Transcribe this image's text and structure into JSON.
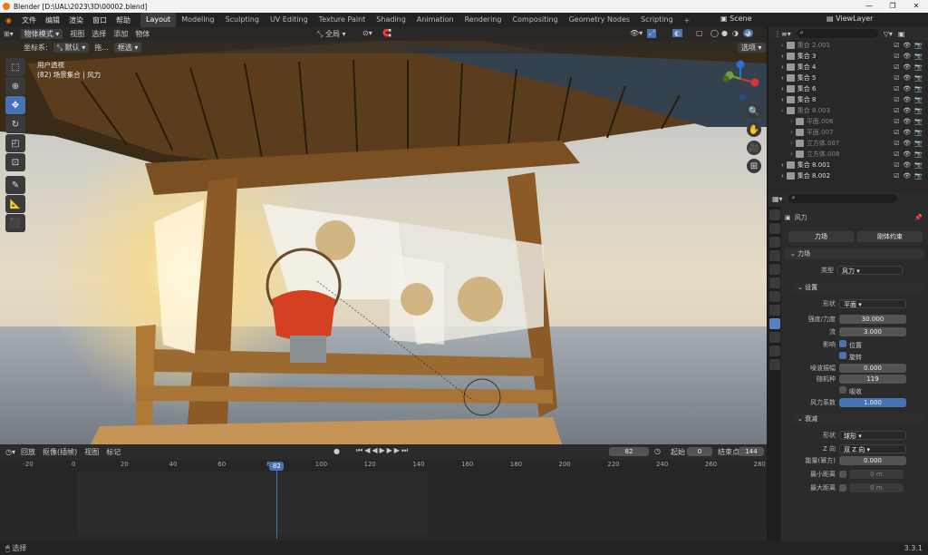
{
  "app": {
    "title": "Blender [D:\\UAL\\2023\\3D\\00002.blend]",
    "version": "3.3.1"
  },
  "menu": [
    "文件",
    "编辑",
    "渲染",
    "窗口",
    "帮助"
  ],
  "workspaces": [
    "Layout",
    "Modeling",
    "Sculpting",
    "UV Editing",
    "Texture Paint",
    "Shading",
    "Animation",
    "Rendering",
    "Compositing",
    "Geometry Nodes",
    "Scripting"
  ],
  "scene": "Scene",
  "viewlayer": "ViewLayer",
  "viewport": {
    "mode": "物体模式",
    "menus": [
      "视图",
      "选择",
      "添加",
      "物体"
    ],
    "coord_label": "坐标系:",
    "coord_value": "默认",
    "drag_label": "拖...",
    "select_mode": "框选",
    "transform": "全局",
    "options": "选项",
    "overlay_view": "用户透视",
    "overlay_info": "(82) 场景集合 | 风力"
  },
  "timeline": {
    "menus": [
      "回放",
      "抠像(插帧)",
      "视图",
      "标记"
    ],
    "current": "82",
    "start_label": "起始",
    "start": "0",
    "end_label": "结束点",
    "end": "144",
    "ticks": [
      "-20",
      "0",
      "20",
      "40",
      "60",
      "80",
      "100",
      "120",
      "140",
      "160",
      "180",
      "200",
      "220",
      "240",
      "260",
      "280"
    ],
    "playhead": "82"
  },
  "status": {
    "left": "选择"
  },
  "outliner": {
    "rows": [
      {
        "name": "集合 2.001",
        "dim": true
      },
      {
        "name": "集合 3",
        "dim": false
      },
      {
        "name": "集合 4",
        "dim": false
      },
      {
        "name": "集合 5",
        "dim": false
      },
      {
        "name": "集合 6",
        "dim": false
      },
      {
        "name": "集合 8",
        "dim": false
      },
      {
        "name": "集合 8.003",
        "dim": true
      },
      {
        "name": "平面.006",
        "dim": true
      },
      {
        "name": "平面.007",
        "dim": true
      },
      {
        "name": "立方体.007",
        "dim": true
      },
      {
        "name": "立方体.008",
        "dim": true
      },
      {
        "name": "集合 8.001",
        "dim": false
      },
      {
        "name": "集合 8.002",
        "dim": false
      }
    ]
  },
  "props": {
    "object": "风力",
    "btn_force": "力场",
    "btn_rigid": "刚体约束",
    "section_force": "力场",
    "type_label": "类型",
    "type_value": "风力",
    "section_settings": "设置",
    "shape_label": "形状",
    "shape_value": "平面",
    "strength_label": "强度/力度",
    "strength": "30.000",
    "flow_label": "流",
    "flow": "3.000",
    "affect_label": "影响",
    "loc": "位置",
    "rot": "旋转",
    "noise_label": "噪波振幅",
    "noise": "0.000",
    "seed_label": "随机种",
    "seed": "119",
    "absorb": "吸收",
    "windfactor_label": "风力系数",
    "windfactor": "1.000",
    "section_falloff": "衰减",
    "fshape_label": "形状",
    "fshape_value": "球形",
    "z_label": "Z 向",
    "z_value": "双 Z 向",
    "power_label": "能量(幂方)",
    "power": "0.000",
    "min_label": "最小距离",
    "min": "0 m",
    "max_label": "最大距离",
    "max": "0 m"
  }
}
